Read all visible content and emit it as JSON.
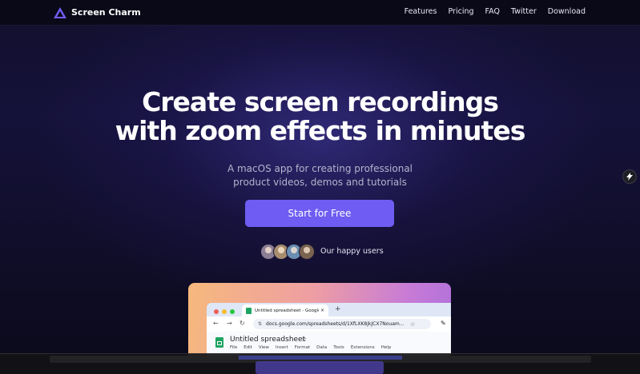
{
  "nav": {
    "brand": "Screen Charm",
    "links": [
      "Features",
      "Pricing",
      "FAQ",
      "Twitter",
      "Download"
    ]
  },
  "hero": {
    "headline_line1": "Create screen recordings",
    "headline_line2": "with zoom effects in minutes",
    "sub_line1": "A macOS app for creating professional",
    "sub_line2": "product videos, demos and tutorials",
    "cta": "Start for Free",
    "social_proof": "Our happy users"
  },
  "preview": {
    "tab_title": "Untitled spreadsheet - Google",
    "tab_close": "×",
    "new_tab": "+",
    "url": "docs.google.com/spreadsheets/d/1XfLXK8jkJCX7Nouam...",
    "doc_title": "Untitled spreadsheet",
    "menus": [
      "File",
      "Edit",
      "View",
      "Insert",
      "Format",
      "Data",
      "Tools",
      "Extensions",
      "Help"
    ]
  },
  "icons": {
    "logo": "triangle-logo-icon",
    "side_badge": "lightning-icon"
  },
  "colors": {
    "accent": "#6f5cf2",
    "background": "#0b0a1a"
  }
}
